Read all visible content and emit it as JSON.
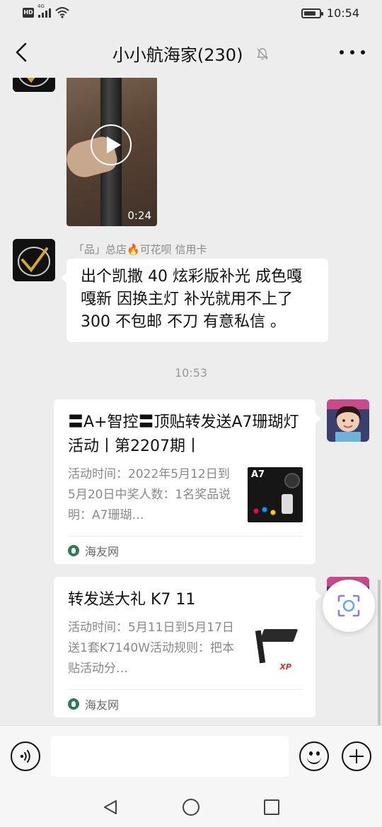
{
  "status_bar": {
    "network": "4G",
    "time": "10:54",
    "battery_level": 0.8
  },
  "header": {
    "title": "小小航海家(230)"
  },
  "messages": {
    "video": {
      "duration": "0:24"
    },
    "text_message": {
      "sender": "「品」总店🔥可花呗 信用卡",
      "text": "出个凯撒 40 炫彩版补光 成色嘎嘎新 因换主灯 补光就用不上了 300 不包邮 不刀 有意私信 。"
    },
    "timestamp": "10:53",
    "cards": [
      {
        "title": "〓A+智控〓顶贴转发送A7珊瑚灯活动丨第2207期丨",
        "description": "活动时间：2022年5月12日到5月20日中奖人数：1名奖品说明：A7珊瑚…",
        "thumb_label": "A7",
        "source": "海友网"
      },
      {
        "title": "转发送大礼 K7 11",
        "description": "活动时间：5月11日到5月17日送1套K7140W活动规则：把本贴活动分…",
        "thumb_label": "XP",
        "source": "海友网"
      }
    ]
  },
  "input_bar": {
    "text_value": ""
  },
  "colors": {
    "background": "#ededed",
    "bubble": "#ffffff",
    "secondary_text": "#888888"
  }
}
